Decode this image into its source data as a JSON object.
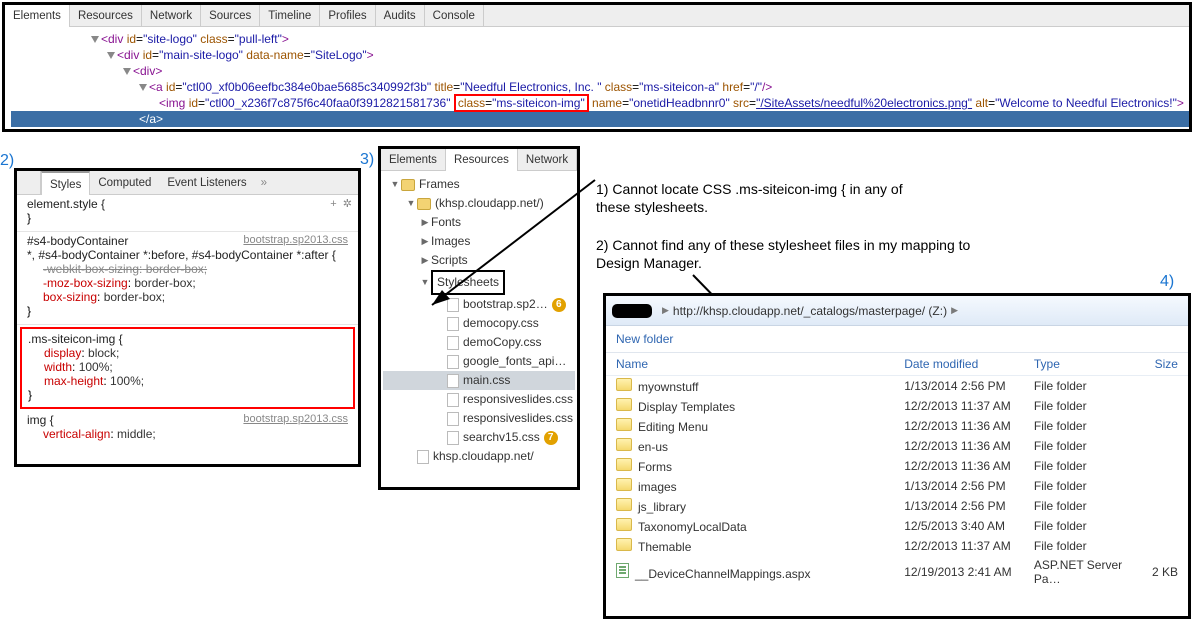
{
  "panel_labels": [
    "1)",
    "2)",
    "3)",
    "4)"
  ],
  "devtools_tabs": [
    "Elements",
    "Resources",
    "Network",
    "Sources",
    "Timeline",
    "Profiles",
    "Audits",
    "Console"
  ],
  "dom_tree": {
    "l1": {
      "tag": "div",
      "attrs": "id=\"site-logo\" class=\"pull-left\""
    },
    "l2": {
      "tag": "div",
      "attrs": "id=\"main-site-logo\" data-name=\"SiteLogo\""
    },
    "l3": {
      "tag": "div",
      "attrs": ""
    },
    "a_pre": "<a id=\"",
    "a_id": "ctl00_xf0b06eefbc384e0bae5685c340992f3b",
    "a_mid1": "\" title=\"",
    "a_title": "Needful Electronics, Inc. ",
    "a_mid2": "\" class=\"",
    "a_class": "ms-siteicon-a",
    "a_mid3": "\" href=\"",
    "a_href": "/",
    "a_end": "\"/>",
    "img_pre": "<img id=\"",
    "img_id": "ctl00_x236f7c875f6c40faa0f3912821581736",
    "img_mid1": "\" ",
    "img_class_full": "class=\"ms-siteicon-img\"",
    "img_mid2": " name=\"",
    "img_name": "onetidHeadbnnr0",
    "img_mid3": "\" src=\"",
    "img_src": "/SiteAssets/needful%20electronics.png",
    "img_mid4": "\" alt=\"",
    "img_alt": "Welcome to Needful Electronics!",
    "img_end": "\">",
    "close": "</a>"
  },
  "styles_subtabs": [
    "Styles",
    "Computed",
    "Event Listeners"
  ],
  "styles": {
    "block1": {
      "selector": "element.style {",
      "close": "}",
      "plus": "+",
      "gear": "✲"
    },
    "block2": {
      "selector": "#s4-bodyContainer",
      "src": "bootstrap.sp2013.css",
      "line2": "*, #s4-bodyContainer *:before, #s4-bodyContainer *:after {",
      "p1": {
        "n": "-webkit-box-sizing",
        "v": " border-box;"
      },
      "p2": {
        "n": "-moz-box-sizing",
        "v": " border-box;"
      },
      "p3": {
        "n": "box-sizing",
        "v": " border-box;"
      },
      "close": "}"
    },
    "block3": {
      "selector": ".ms-siteicon-img {",
      "p1": {
        "n": "display",
        "v": " block;"
      },
      "p2": {
        "n": "width",
        "v": " 100%;"
      },
      "p3": {
        "n": "max-height",
        "v": " 100%;"
      },
      "close": "}"
    },
    "block4": {
      "selector": "img {",
      "src": "bootstrap.sp2013.css",
      "p1": {
        "n": "vertical-align",
        "v": " middle;"
      }
    }
  },
  "resources_tabs": [
    "Elements",
    "Resources",
    "Network"
  ],
  "resources_tree": {
    "root": "Frames",
    "domain": "(khsp.cloudapp.net/)",
    "fonts": "Fonts",
    "images": "Images",
    "scripts": "Scripts",
    "stylesheets": "Stylesheets",
    "files": [
      {
        "name": "bootstrap.sp2…",
        "badge": "6"
      },
      {
        "name": "democopy.css",
        "badge": ""
      },
      {
        "name": "demoCopy.css",
        "badge": ""
      },
      {
        "name": "google_fonts_api…",
        "badge": ""
      },
      {
        "name": "main.css",
        "badge": ""
      },
      {
        "name": "responsiveslides.css",
        "badge": ""
      },
      {
        "name": "responsiveslides.css",
        "badge": ""
      },
      {
        "name": "searchv15.css",
        "badge": "7"
      }
    ],
    "last": "khsp.cloudapp.net/"
  },
  "annotations": {
    "a1": "1) Cannot locate CSS .ms-siteicon-img { in any of these stylesheets.",
    "a2": "2) Cannot find any of these stylesheet files in my mapping to Design Manager."
  },
  "explorer": {
    "breadcrumb": {
      "url": "http://khsp.cloudapp.net/_catalogs/masterpage/ (Z:)"
    },
    "cmd": "New folder",
    "headers": [
      "Name",
      "Date modified",
      "Type",
      "Size"
    ],
    "rows": [
      {
        "icon": "folder",
        "name": "myownstuff",
        "date": "1/13/2014 2:56 PM",
        "type": "File folder",
        "size": ""
      },
      {
        "icon": "folder",
        "name": "Display Templates",
        "date": "12/2/2013 11:37 AM",
        "type": "File folder",
        "size": ""
      },
      {
        "icon": "folder",
        "name": "Editing Menu",
        "date": "12/2/2013 11:36 AM",
        "type": "File folder",
        "size": ""
      },
      {
        "icon": "folder",
        "name": "en-us",
        "date": "12/2/2013 11:36 AM",
        "type": "File folder",
        "size": ""
      },
      {
        "icon": "folder",
        "name": "Forms",
        "date": "12/2/2013 11:36 AM",
        "type": "File folder",
        "size": ""
      },
      {
        "icon": "folder",
        "name": "images",
        "date": "1/13/2014 2:56 PM",
        "type": "File folder",
        "size": ""
      },
      {
        "icon": "folder",
        "name": "js_library",
        "date": "1/13/2014 2:56 PM",
        "type": "File folder",
        "size": ""
      },
      {
        "icon": "folder",
        "name": "TaxonomyLocalData",
        "date": "12/5/2013 3:40 AM",
        "type": "File folder",
        "size": ""
      },
      {
        "icon": "folder",
        "name": "Themable",
        "date": "12/2/2013 11:37 AM",
        "type": "File folder",
        "size": ""
      },
      {
        "icon": "file",
        "name": "__DeviceChannelMappings.aspx",
        "date": "12/19/2013 2:41 AM",
        "type": "ASP.NET Server Pa…",
        "size": "2 KB"
      }
    ]
  }
}
